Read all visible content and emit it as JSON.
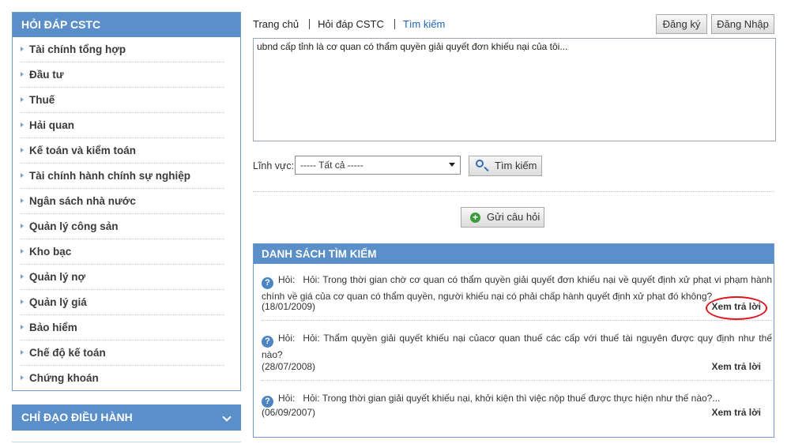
{
  "sidebar": {
    "title": "HỎI ĐÁP CSTC",
    "items": [
      {
        "label": "Tài chính tổng hợp"
      },
      {
        "label": "Đầu tư"
      },
      {
        "label": "Thuế"
      },
      {
        "label": "Hải quan"
      },
      {
        "label": "Kế toán và kiểm toán"
      },
      {
        "label": "Tài chính hành chính sự nghiệp"
      },
      {
        "label": "Ngân sách nhà nước"
      },
      {
        "label": "Quản lý công sản"
      },
      {
        "label": "Kho bạc"
      },
      {
        "label": "Quản lý nợ"
      },
      {
        "label": "Quản lý giá"
      },
      {
        "label": "Bảo hiểm"
      },
      {
        "label": "Chế độ kế toán"
      },
      {
        "label": "Chứng khoán"
      }
    ],
    "section2_title": "CHỈ ĐẠO ĐIỀU HÀNH"
  },
  "breadcrumb": {
    "home": "Trang chủ",
    "qa": "Hỏi đáp CSTC",
    "search": "Tìm kiếm"
  },
  "auth": {
    "register": "Đăng ký",
    "login": "Đăng Nhập"
  },
  "search": {
    "query": "ubnd cấp tỉnh là cơ quan có thẩm quyền giải quyết đơn khiếu nại của tôi...",
    "field_label": "Lĩnh vực:",
    "field_value": "----- Tất cả -----",
    "button": "Tìm kiếm",
    "send_button": "Gửi câu hỏi"
  },
  "results": {
    "title": "DANH SÁCH TÌM KIẾM",
    "items": [
      {
        "prefix": "Hỏi:",
        "text": "Hỏi: Trong thời gian chờ cơ quan có thẩm quyền giải quyết đơn khiếu nại về quyết định xử phạt vi phạm hành chính về giá của cơ quan có thẩm quyền, người khiếu nại có phải chấp hành quyết định xử phạt đó không?",
        "date": "(18/01/2009)",
        "view": "Xem trả lời"
      },
      {
        "prefix": "Hỏi:",
        "text": "Hỏi: Thẩm quyền giải quyết khiếu nại củacơ quan thuế các cấp với thuế tài nguyên được quy định như thế nào?",
        "date": "(28/07/2008)",
        "view": "Xem trả lời"
      },
      {
        "prefix": "Hỏi:",
        "text": "Hỏi: Trong thời gian giải quyết khiếu nại, khởi kiện thì việc nộp thuế được thực hiện như thế nào?...",
        "date": "(06/09/2007)",
        "view": "Xem trả lời"
      }
    ]
  },
  "colors": {
    "header_blue": "#5b8fc9",
    "highlight_circle": "#e0141d"
  }
}
